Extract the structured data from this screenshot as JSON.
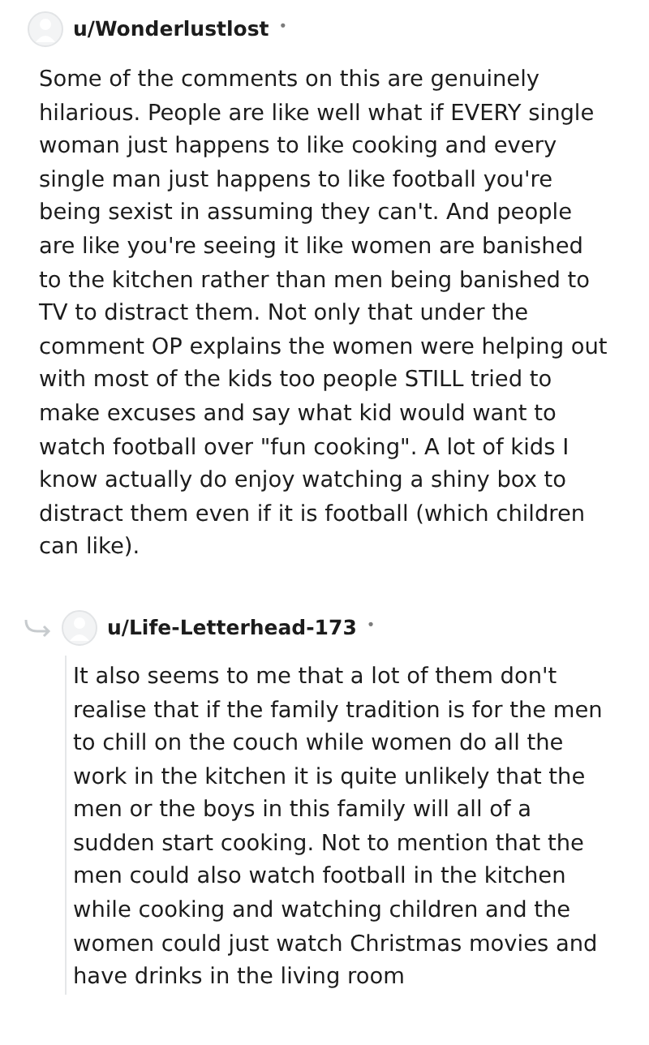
{
  "comments": [
    {
      "author": "u/Wonderlustlost",
      "separator": "•",
      "is_reply": false,
      "body": "Some of the comments on this are genuinely hilarious. People are like well what if EVERY single woman just happens to like cooking and every single man just happens to like football you're being sexist in assuming they can't. And people are like you're seeing it like women are banished to the kitchen rather than men being banished to TV to distract them. Not only that under the comment OP explains the women were helping out with most of the kids too people STILL tried to make excuses and say what kid would want to watch football over \"fun cooking\". A lot of kids I know actually do enjoy watching a shiny box to distract them even if it is football (which children can like)."
    },
    {
      "author": "u/Life-Letterhead-173",
      "separator": "•",
      "is_reply": true,
      "body": "It also seems to me that a lot of them don't realise that if the family tradition is for the men to chill on the couch while women do all the work in the kitchen it is quite unlikely that the men or the boys in this family will all of a sudden start cooking. Not to mention that the men could also watch football in the kitchen while cooking and watching children and the women could just watch Christmas movies and have drinks in the living room"
    }
  ]
}
